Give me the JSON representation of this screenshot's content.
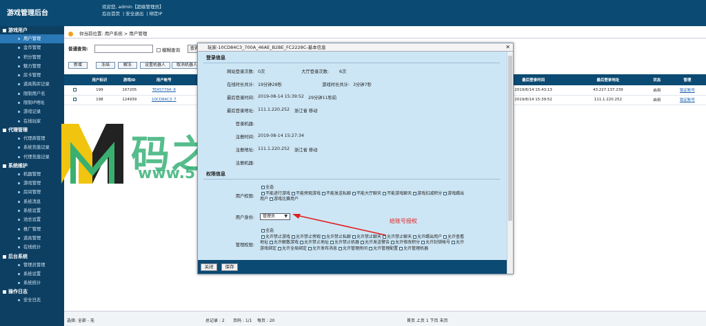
{
  "header": {
    "app_title": "游戏管理后台",
    "welcome": "欢迎您, admin【超级管理员】",
    "link_home": "后台首页",
    "link_logout": "安全退出",
    "link_bind": "绑定IP"
  },
  "sidebar": {
    "sections": [
      {
        "title": "游戏用户",
        "items": [
          "用户管理",
          "金币管理",
          "积分管理",
          "魅力管理",
          "房卡管理",
          "道具购买记录",
          "限制用户名",
          "限制IP地址",
          "游戏记录",
          "在线玩家"
        ]
      },
      {
        "title": "代理管理",
        "items": [
          "代理商管理",
          "系统充值记录",
          "代理充值记录"
        ]
      },
      {
        "title": "系统维护",
        "items": [
          "机器管理",
          "游戏管理",
          "房间管理",
          "系统消息",
          "系统设置",
          "池总设置",
          "推广管理",
          "道具管理",
          "在线统计"
        ]
      },
      {
        "title": "后台系统",
        "items": [
          "管理员管理",
          "系统设置",
          "系统统计"
        ]
      },
      {
        "title": "操作日志",
        "items": [
          "安全日志"
        ]
      }
    ],
    "active": "用户管理"
  },
  "breadcrumb": "你当前位置: 用户系统 > 用户管理",
  "search": {
    "label": "普通查询:",
    "value": "",
    "fuzzy": "模糊查询",
    "button": "查询"
  },
  "toolbar": [
    "新增",
    "冻结",
    "解冻",
    "设置机器人",
    "取消机器人"
  ],
  "table": {
    "headers": [
      "",
      "用户标识",
      "游戏ID",
      "用户帐号",
      "",
      "",
      "",
      "",
      "登录地址",
      "登录次数",
      "最后登录时间",
      "最后登录地址",
      "状态",
      "管理"
    ],
    "rows": [
      [
        "",
        "199",
        "167205",
        "TE45779A_8",
        "",
        "",
        "",
        "",
        ".137.239",
        "2",
        "2019/8/14 15:43:13",
        "43.227.137.239",
        "启用",
        "锁定账号"
      ],
      [
        "",
        "198",
        "124939",
        "10CD84C3_7",
        "6Ya...",
        "",
        "",
        "",
        ".220.252",
        "6",
        "2019/8/14 15:39:52",
        "111.1.220.252",
        "启用",
        "锁定账号"
      ]
    ]
  },
  "footer": {
    "select": "选择:  全部 - 无",
    "total": "总记录 : 2",
    "pages": "页码 : 1/1",
    "per": "每页 : 20",
    "nav": "首页 上页 1 下页 末页"
  },
  "watermark": {
    "text": "码之家",
    "url": "www.573ym.com"
  },
  "dialog": {
    "title": "玩家-10CD84C3_700A_46AE_B2BE_FC2228C-基本信息",
    "login_title": "登录信息",
    "web_logins_label": "网站登录次数:",
    "web_logins": "0次",
    "hall_logins_label": "大厅登录次数:",
    "hall_logins": "6次",
    "online_label": "在线时长共计:",
    "online": "19分钟28秒",
    "game_label": "游戏时长共计:",
    "game": "3分钟7秒",
    "last_login_label": "最后登录时间:",
    "last_login": "2019-08-14 15:39:52",
    "last_login_ago": "29分钟11秒前",
    "last_addr_label": "最后登录地址:",
    "last_addr": "111.1.220.252",
    "last_addr_loc": "浙江省 移动",
    "login_machine_label": "登录机器:",
    "reg_time_label": "注册时间:",
    "reg_time": "2019-08-14 15:27:34",
    "reg_addr_label": "注册地址:",
    "reg_addr": "111.1.220.252",
    "reg_addr_loc": "浙江省 移动",
    "reg_machine_label": "注册机器:",
    "perm_title": "权限信息",
    "user_perm_label": "用户权限:",
    "user_perms": [
      "全选",
      "不能进行游戏",
      "不能旁观游戏",
      "不能发送私聊",
      "不能大厅聊天",
      "不能游戏聊天",
      "游戏扣减积分",
      "游戏踢出用户",
      "游戏比赛用户"
    ],
    "role_label": "用户身份:",
    "role_value": "管理员",
    "admin_perm_label": "管理权限:",
    "admin_perms": [
      "全选",
      "允许禁止游戏",
      "允许禁止旁观",
      "允许禁止私聊",
      "允许禁止聊天",
      "允许禁止聊天",
      "允许踢出用户",
      "允许查看地址",
      "允许解散游戏",
      "允许禁止地址",
      "允许禁止机器",
      "允许发送警告",
      "允许修改积分",
      "允许封锁帐号",
      "允许游戏绑定",
      "允许全局绑定",
      "允许发布消息",
      "允许管理房间",
      "允许管理配置",
      "允许管理机器"
    ],
    "close_btn": "关闭",
    "save_btn": "保存"
  },
  "annotation": "给账号授权"
}
